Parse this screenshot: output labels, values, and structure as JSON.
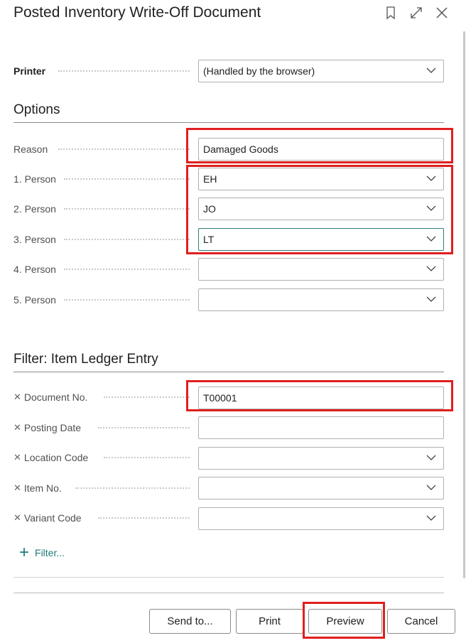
{
  "dialog": {
    "title": "Posted Inventory Write-Off Document"
  },
  "printer": {
    "label": "Printer",
    "value": "(Handled by the browser)"
  },
  "options": {
    "heading": "Options",
    "reason_label": "Reason",
    "reason_value": "Damaged Goods",
    "persons": [
      {
        "label": "1. Person",
        "value": "EH"
      },
      {
        "label": "2. Person",
        "value": "JO"
      },
      {
        "label": "3. Person",
        "value": "LT"
      },
      {
        "label": "4. Person",
        "value": ""
      },
      {
        "label": "5. Person",
        "value": ""
      }
    ]
  },
  "filter": {
    "heading": "Filter: Item Ledger Entry",
    "fields": [
      {
        "label": "Document No.",
        "value": "T00001"
      },
      {
        "label": "Posting Date",
        "value": ""
      },
      {
        "label": "Location Code",
        "value": ""
      },
      {
        "label": "Item No.",
        "value": ""
      },
      {
        "label": "Variant Code",
        "value": ""
      }
    ],
    "add_filter_label": "Filter..."
  },
  "buttons": {
    "send_to": "Send to...",
    "print": "Print",
    "preview": "Preview",
    "cancel": "Cancel"
  },
  "icons": {
    "bookmark": "bookmark-icon",
    "expand": "expand-icon",
    "close": "close-icon"
  },
  "colors": {
    "highlight": "#e01f1f",
    "accent": "#1f7a7a"
  }
}
